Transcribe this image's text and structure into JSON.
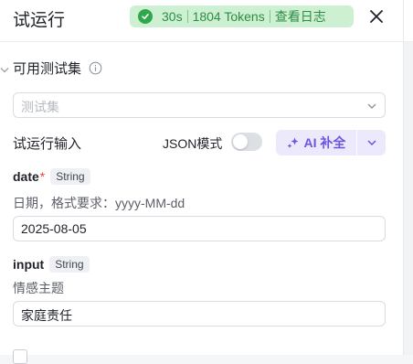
{
  "header": {
    "title": "试运行",
    "status": {
      "duration": "30s",
      "tokens": "1804 Tokens",
      "log_link": "查看日志",
      "color": "#2ea84a"
    },
    "close_icon": "close-icon"
  },
  "test_set": {
    "section_title": "可用测试集",
    "info_icon": "info-icon",
    "select_placeholder": "测试集"
  },
  "run_input": {
    "label": "试运行输入",
    "json_mode_label": "JSON模式",
    "json_mode_on": false,
    "ai_button_label": "AI 补全",
    "accent_color": "#6a55e0"
  },
  "fields": [
    {
      "name": "date",
      "required_mark": "*",
      "type": "String",
      "description": "日期，格式要求：yyyy-MM-dd",
      "value": "2025-08-05"
    },
    {
      "name": "input",
      "type": "String",
      "description": "情感主题",
      "value": "家庭责任"
    }
  ]
}
